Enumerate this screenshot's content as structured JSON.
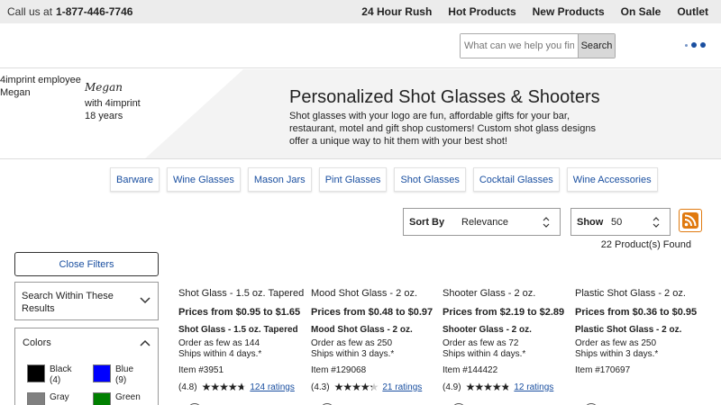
{
  "topbar": {
    "call_label": "Call us at",
    "phone": "1-877-446-7746",
    "nav": [
      "24 Hour Rush",
      "Hot Products",
      "New Products",
      "On Sale",
      "Outlet"
    ]
  },
  "header": {
    "search_placeholder": "What can we help you find?",
    "search_button": "Search"
  },
  "hero": {
    "employee_line1": "4imprint employee",
    "employee_line2": "Megan",
    "signature": "Megan",
    "tenure_line1": "with 4imprint",
    "tenure_line2": "18 years",
    "title": "Personalized Shot Glasses & Shooters",
    "description": "Shot glasses with your logo are fun, affordable gifts for your bar, restaurant, motel and gift shop customers! Custom shot glass designs offer a unique way to hit them with your best shot!"
  },
  "categories": [
    "Barware",
    "Wine Glasses",
    "Mason Jars",
    "Pint Glasses",
    "Shot Glasses",
    "Cocktail Glasses",
    "Wine Accessories"
  ],
  "sort": {
    "label": "Sort By",
    "value": "Relevance"
  },
  "show": {
    "label": "Show",
    "value": "50"
  },
  "results_count": "22 Product(s) Found",
  "filters": {
    "close_label": "Close Filters",
    "search_within_label": "Search Within These Results",
    "colors_label": "Colors",
    "colors": [
      {
        "name": "Black",
        "count": "(4)",
        "hex": "#000000"
      },
      {
        "name": "Blue",
        "count": "(9)",
        "hex": "#0000ff"
      },
      {
        "name": "Gray",
        "count": "",
        "hex": "#808080"
      },
      {
        "name": "Green",
        "count": "",
        "hex": "#008000"
      }
    ]
  },
  "products": [
    {
      "name": "Shot Glass - 1.5 oz. Tapered",
      "price": "Prices from $0.95 to $1.65",
      "subtitle": "Shot Glass - 1.5 oz. Tapered",
      "minimum": "Order as few as 144",
      "ships": "Ships within 4 days.*",
      "item": "Item #3951",
      "rating_text": "(4.8)",
      "rating": 4.8,
      "ratings_link": "124 ratings"
    },
    {
      "name": "Mood Shot Glass - 2 oz.",
      "price": "Prices from $0.48 to $0.97",
      "subtitle": "Mood Shot Glass - 2 oz.",
      "minimum": "Order as few as 250",
      "ships": "Ships within 3 days.*",
      "item": "Item #129068",
      "rating_text": "(4.3)",
      "rating": 4.3,
      "ratings_link": "21 ratings"
    },
    {
      "name": "Shooter Glass - 2 oz.",
      "price": "Prices from $2.19 to $2.89",
      "subtitle": "Shooter Glass - 2 oz.",
      "minimum": "Order as few as 72",
      "ships": "Ships within 4 days.*",
      "item": "Item #144422",
      "rating_text": "(4.9)",
      "rating": 4.9,
      "ratings_link": "12 ratings"
    },
    {
      "name": "Plastic Shot Glass - 2 oz.",
      "price": "Prices from $0.36 to $0.95",
      "subtitle": "Plastic Shot Glass - 2 oz.",
      "minimum": "Order as few as 250",
      "ships": "Ships within 3 days.*",
      "item": "Item #170697",
      "rating_text": "",
      "rating": 0,
      "ratings_link": ""
    }
  ],
  "colors": {
    "link": "#1a4fa0",
    "rss": "#e07a10"
  }
}
